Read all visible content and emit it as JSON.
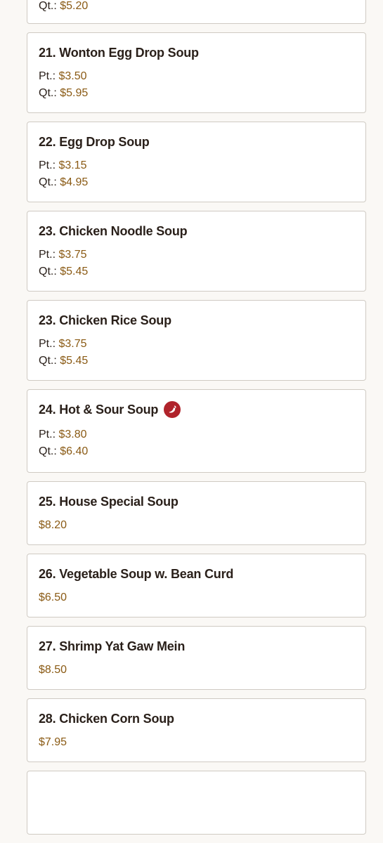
{
  "items": [
    {
      "title": "",
      "pt": null,
      "qt": "$5.20"
    },
    {
      "title": "21. Wonton Egg Drop Soup",
      "pt": "$3.50",
      "qt": "$5.95"
    },
    {
      "title": "22. Egg Drop Soup",
      "pt": "$3.15",
      "qt": "$4.95"
    },
    {
      "title": "23. Chicken Noodle Soup",
      "pt": "$3.75",
      "qt": "$5.45"
    },
    {
      "title": "23. Chicken Rice Soup",
      "pt": "$3.75",
      "qt": "$5.45"
    },
    {
      "title": "24. Hot & Sour Soup",
      "pt": "$3.80",
      "qt": "$6.40",
      "icon": "chili-pepper-icon",
      "icon_color": "#b0232b"
    },
    {
      "title": "25. House Special Soup",
      "price": "$8.20"
    },
    {
      "title": "26. Vegetable Soup w. Bean Curd",
      "price": "$6.50"
    },
    {
      "title": "27. Shrimp Yat Gaw Mein",
      "price": "$8.50"
    },
    {
      "title": "28. Chicken Corn Soup",
      "price": "$7.95"
    }
  ],
  "labels": {
    "pt": "Pt.:",
    "qt": "Qt.:"
  },
  "colors": {
    "price": "#8a5a14",
    "title": "#2a201a",
    "card_border": "#cfcac3",
    "background": "#faf8f5"
  }
}
